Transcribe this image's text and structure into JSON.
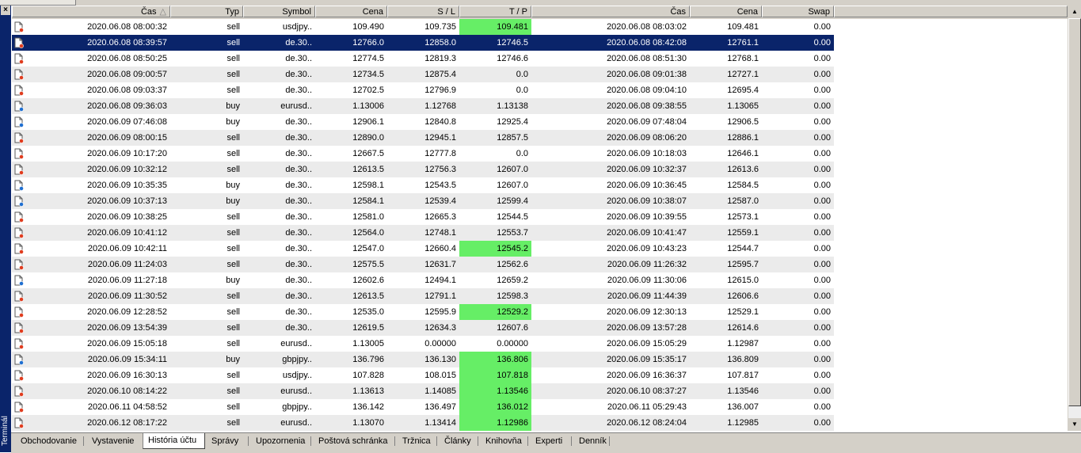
{
  "window": {
    "side_title": "Terminál",
    "close_glyph": "×"
  },
  "columns": [
    "Čas",
    "Typ",
    "Symbol",
    "Cena",
    "S / L",
    "T / P",
    "Čas",
    "Cena",
    "Swap"
  ],
  "sort_indicator": "△",
  "rows": [
    {
      "open_time": "2020.06.08 08:00:32",
      "type": "sell",
      "symbol": "usdjpy..",
      "price": "109.490",
      "sl": "109.735",
      "tp": "109.481",
      "tp_hit": true,
      "close_time": "2020.06.08 08:03:02",
      "close_price": "109.481",
      "swap": "0.00"
    },
    {
      "open_time": "2020.06.08 08:39:57",
      "type": "sell",
      "symbol": "de.30..",
      "price": "12766.0",
      "sl": "12858.0",
      "tp": "12746.5",
      "tp_hit": false,
      "close_time": "2020.06.08 08:42:08",
      "close_price": "12761.1",
      "swap": "0.00",
      "selected": true
    },
    {
      "open_time": "2020.06.08 08:50:25",
      "type": "sell",
      "symbol": "de.30..",
      "price": "12774.5",
      "sl": "12819.3",
      "tp": "12746.6",
      "tp_hit": false,
      "close_time": "2020.06.08 08:51:30",
      "close_price": "12768.1",
      "swap": "0.00"
    },
    {
      "open_time": "2020.06.08 09:00:57",
      "type": "sell",
      "symbol": "de.30..",
      "price": "12734.5",
      "sl": "12875.4",
      "tp": "0.0",
      "tp_hit": false,
      "close_time": "2020.06.08 09:01:38",
      "close_price": "12727.1",
      "swap": "0.00"
    },
    {
      "open_time": "2020.06.08 09:03:37",
      "type": "sell",
      "symbol": "de.30..",
      "price": "12702.5",
      "sl": "12796.9",
      "tp": "0.0",
      "tp_hit": false,
      "close_time": "2020.06.08 09:04:10",
      "close_price": "12695.4",
      "swap": "0.00"
    },
    {
      "open_time": "2020.06.08 09:36:03",
      "type": "buy",
      "symbol": "eurusd..",
      "price": "1.13006",
      "sl": "1.12768",
      "tp": "1.13138",
      "tp_hit": false,
      "close_time": "2020.06.08 09:38:55",
      "close_price": "1.13065",
      "swap": "0.00"
    },
    {
      "open_time": "2020.06.09 07:46:08",
      "type": "buy",
      "symbol": "de.30..",
      "price": "12906.1",
      "sl": "12840.8",
      "tp": "12925.4",
      "tp_hit": false,
      "close_time": "2020.06.09 07:48:04",
      "close_price": "12906.5",
      "swap": "0.00"
    },
    {
      "open_time": "2020.06.09 08:00:15",
      "type": "sell",
      "symbol": "de.30..",
      "price": "12890.0",
      "sl": "12945.1",
      "tp": "12857.5",
      "tp_hit": false,
      "close_time": "2020.06.09 08:06:20",
      "close_price": "12886.1",
      "swap": "0.00"
    },
    {
      "open_time": "2020.06.09 10:17:20",
      "type": "sell",
      "symbol": "de.30..",
      "price": "12667.5",
      "sl": "12777.8",
      "tp": "0.0",
      "tp_hit": false,
      "close_time": "2020.06.09 10:18:03",
      "close_price": "12646.1",
      "swap": "0.00"
    },
    {
      "open_time": "2020.06.09 10:32:12",
      "type": "sell",
      "symbol": "de.30..",
      "price": "12613.5",
      "sl": "12756.3",
      "tp": "12607.0",
      "tp_hit": false,
      "close_time": "2020.06.09 10:32:37",
      "close_price": "12613.6",
      "swap": "0.00"
    },
    {
      "open_time": "2020.06.09 10:35:35",
      "type": "buy",
      "symbol": "de.30..",
      "price": "12598.1",
      "sl": "12543.5",
      "tp": "12607.0",
      "tp_hit": false,
      "close_time": "2020.06.09 10:36:45",
      "close_price": "12584.5",
      "swap": "0.00"
    },
    {
      "open_time": "2020.06.09 10:37:13",
      "type": "buy",
      "symbol": "de.30..",
      "price": "12584.1",
      "sl": "12539.4",
      "tp": "12599.4",
      "tp_hit": false,
      "close_time": "2020.06.09 10:38:07",
      "close_price": "12587.0",
      "swap": "0.00"
    },
    {
      "open_time": "2020.06.09 10:38:25",
      "type": "sell",
      "symbol": "de.30..",
      "price": "12581.0",
      "sl": "12665.3",
      "tp": "12544.5",
      "tp_hit": false,
      "close_time": "2020.06.09 10:39:55",
      "close_price": "12573.1",
      "swap": "0.00"
    },
    {
      "open_time": "2020.06.09 10:41:12",
      "type": "sell",
      "symbol": "de.30..",
      "price": "12564.0",
      "sl": "12748.1",
      "tp": "12553.7",
      "tp_hit": false,
      "close_time": "2020.06.09 10:41:47",
      "close_price": "12559.1",
      "swap": "0.00"
    },
    {
      "open_time": "2020.06.09 10:42:11",
      "type": "sell",
      "symbol": "de.30..",
      "price": "12547.0",
      "sl": "12660.4",
      "tp": "12545.2",
      "tp_hit": true,
      "close_time": "2020.06.09 10:43:23",
      "close_price": "12544.7",
      "swap": "0.00"
    },
    {
      "open_time": "2020.06.09 11:24:03",
      "type": "sell",
      "symbol": "de.30..",
      "price": "12575.5",
      "sl": "12631.7",
      "tp": "12562.6",
      "tp_hit": false,
      "close_time": "2020.06.09 11:26:32",
      "close_price": "12595.7",
      "swap": "0.00"
    },
    {
      "open_time": "2020.06.09 11:27:18",
      "type": "buy",
      "symbol": "de.30..",
      "price": "12602.6",
      "sl": "12494.1",
      "tp": "12659.2",
      "tp_hit": false,
      "close_time": "2020.06.09 11:30:06",
      "close_price": "12615.0",
      "swap": "0.00"
    },
    {
      "open_time": "2020.06.09 11:30:52",
      "type": "sell",
      "symbol": "de.30..",
      "price": "12613.5",
      "sl": "12791.1",
      "tp": "12598.3",
      "tp_hit": false,
      "close_time": "2020.06.09 11:44:39",
      "close_price": "12606.6",
      "swap": "0.00"
    },
    {
      "open_time": "2020.06.09 12:28:52",
      "type": "sell",
      "symbol": "de.30..",
      "price": "12535.0",
      "sl": "12595.9",
      "tp": "12529.2",
      "tp_hit": true,
      "close_time": "2020.06.09 12:30:13",
      "close_price": "12529.1",
      "swap": "0.00"
    },
    {
      "open_time": "2020.06.09 13:54:39",
      "type": "sell",
      "symbol": "de.30..",
      "price": "12619.5",
      "sl": "12634.3",
      "tp": "12607.6",
      "tp_hit": false,
      "close_time": "2020.06.09 13:57:28",
      "close_price": "12614.6",
      "swap": "0.00"
    },
    {
      "open_time": "2020.06.09 15:05:18",
      "type": "sell",
      "symbol": "eurusd..",
      "price": "1.13005",
      "sl": "0.00000",
      "tp": "0.00000",
      "tp_hit": false,
      "close_time": "2020.06.09 15:05:29",
      "close_price": "1.12987",
      "swap": "0.00"
    },
    {
      "open_time": "2020.06.09 15:34:11",
      "type": "buy",
      "symbol": "gbpjpy..",
      "price": "136.796",
      "sl": "136.130",
      "tp": "136.806",
      "tp_hit": true,
      "close_time": "2020.06.09 15:35:17",
      "close_price": "136.809",
      "swap": "0.00"
    },
    {
      "open_time": "2020.06.09 16:30:13",
      "type": "sell",
      "symbol": "usdjpy..",
      "price": "107.828",
      "sl": "108.015",
      "tp": "107.818",
      "tp_hit": true,
      "close_time": "2020.06.09 16:36:37",
      "close_price": "107.817",
      "swap": "0.00"
    },
    {
      "open_time": "2020.06.10 08:14:22",
      "type": "sell",
      "symbol": "eurusd..",
      "price": "1.13613",
      "sl": "1.14085",
      "tp": "1.13546",
      "tp_hit": true,
      "close_time": "2020.06.10 08:37:27",
      "close_price": "1.13546",
      "swap": "0.00"
    },
    {
      "open_time": "2020.06.11 04:58:52",
      "type": "sell",
      "symbol": "gbpjpy..",
      "price": "136.142",
      "sl": "136.497",
      "tp": "136.012",
      "tp_hit": true,
      "close_time": "2020.06.11 05:29:43",
      "close_price": "136.007",
      "swap": "0.00"
    },
    {
      "open_time": "2020.06.12 08:17:22",
      "type": "sell",
      "symbol": "eurusd..",
      "price": "1.13070",
      "sl": "1.13414",
      "tp": "1.12986",
      "tp_hit": true,
      "close_time": "2020.06.12 08:24:04",
      "close_price": "1.12985",
      "swap": "0.00"
    }
  ],
  "tabs": [
    {
      "label": "Obchodovanie"
    },
    {
      "label": "Vystavenie"
    },
    {
      "label": "História účtu",
      "active": true
    },
    {
      "label": "Správy"
    },
    {
      "label": "Upozornenia"
    },
    {
      "label": "Poštová schránka"
    },
    {
      "label": "Tržnica"
    },
    {
      "label": "Články"
    },
    {
      "label": "Knihovňa"
    },
    {
      "label": "Experti"
    },
    {
      "label": "Denník"
    }
  ],
  "colors": {
    "selected_row": "#0a246a",
    "tp_highlight": "#66ee66",
    "alt_row": "#ebebeb",
    "sell_dot": "#e03c1e",
    "buy_dot": "#1f6fd1"
  }
}
